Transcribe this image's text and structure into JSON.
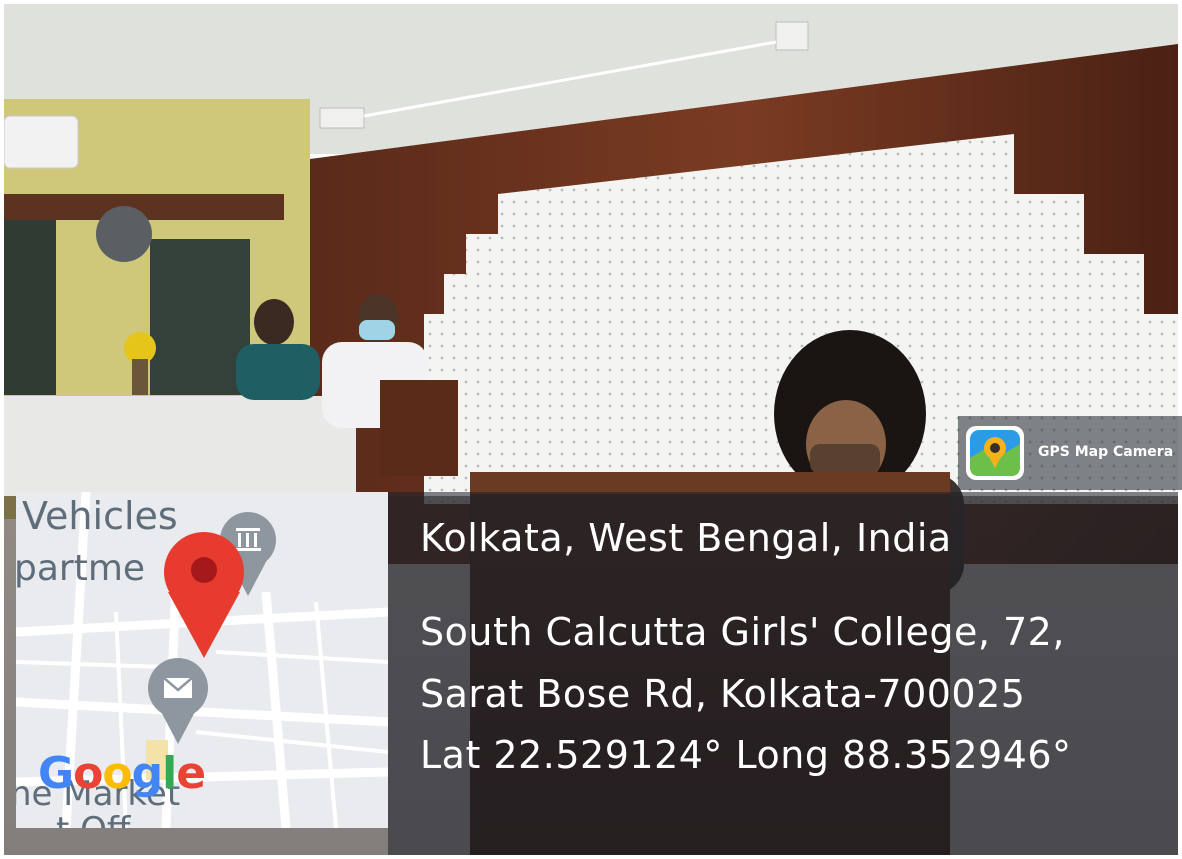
{
  "badge": {
    "label": "GPS Map Camera",
    "icon": "map-pin-camera-icon"
  },
  "location": {
    "city": "Kolkata, West Bengal, India",
    "address_line1": "South Calcutta Girls' College, 72,",
    "address_line2": "Sarat Bose Rd, Kolkata-700025",
    "coordinates": "Lat 22.529124° Long 88.352946°"
  },
  "map": {
    "labels": [
      "Vehicles",
      "partme",
      "ne Market",
      "t Off"
    ],
    "brand": [
      "G",
      "o",
      "o",
      "g",
      "l",
      "e"
    ],
    "brand_colors": [
      "#4285F4",
      "#EA4335",
      "#FBBC05",
      "#4285F4",
      "#34A853",
      "#EA4335"
    ],
    "pin_color": "#EA4335",
    "icons": [
      "map-pin-icon",
      "museum-icon",
      "post-office-icon"
    ]
  }
}
